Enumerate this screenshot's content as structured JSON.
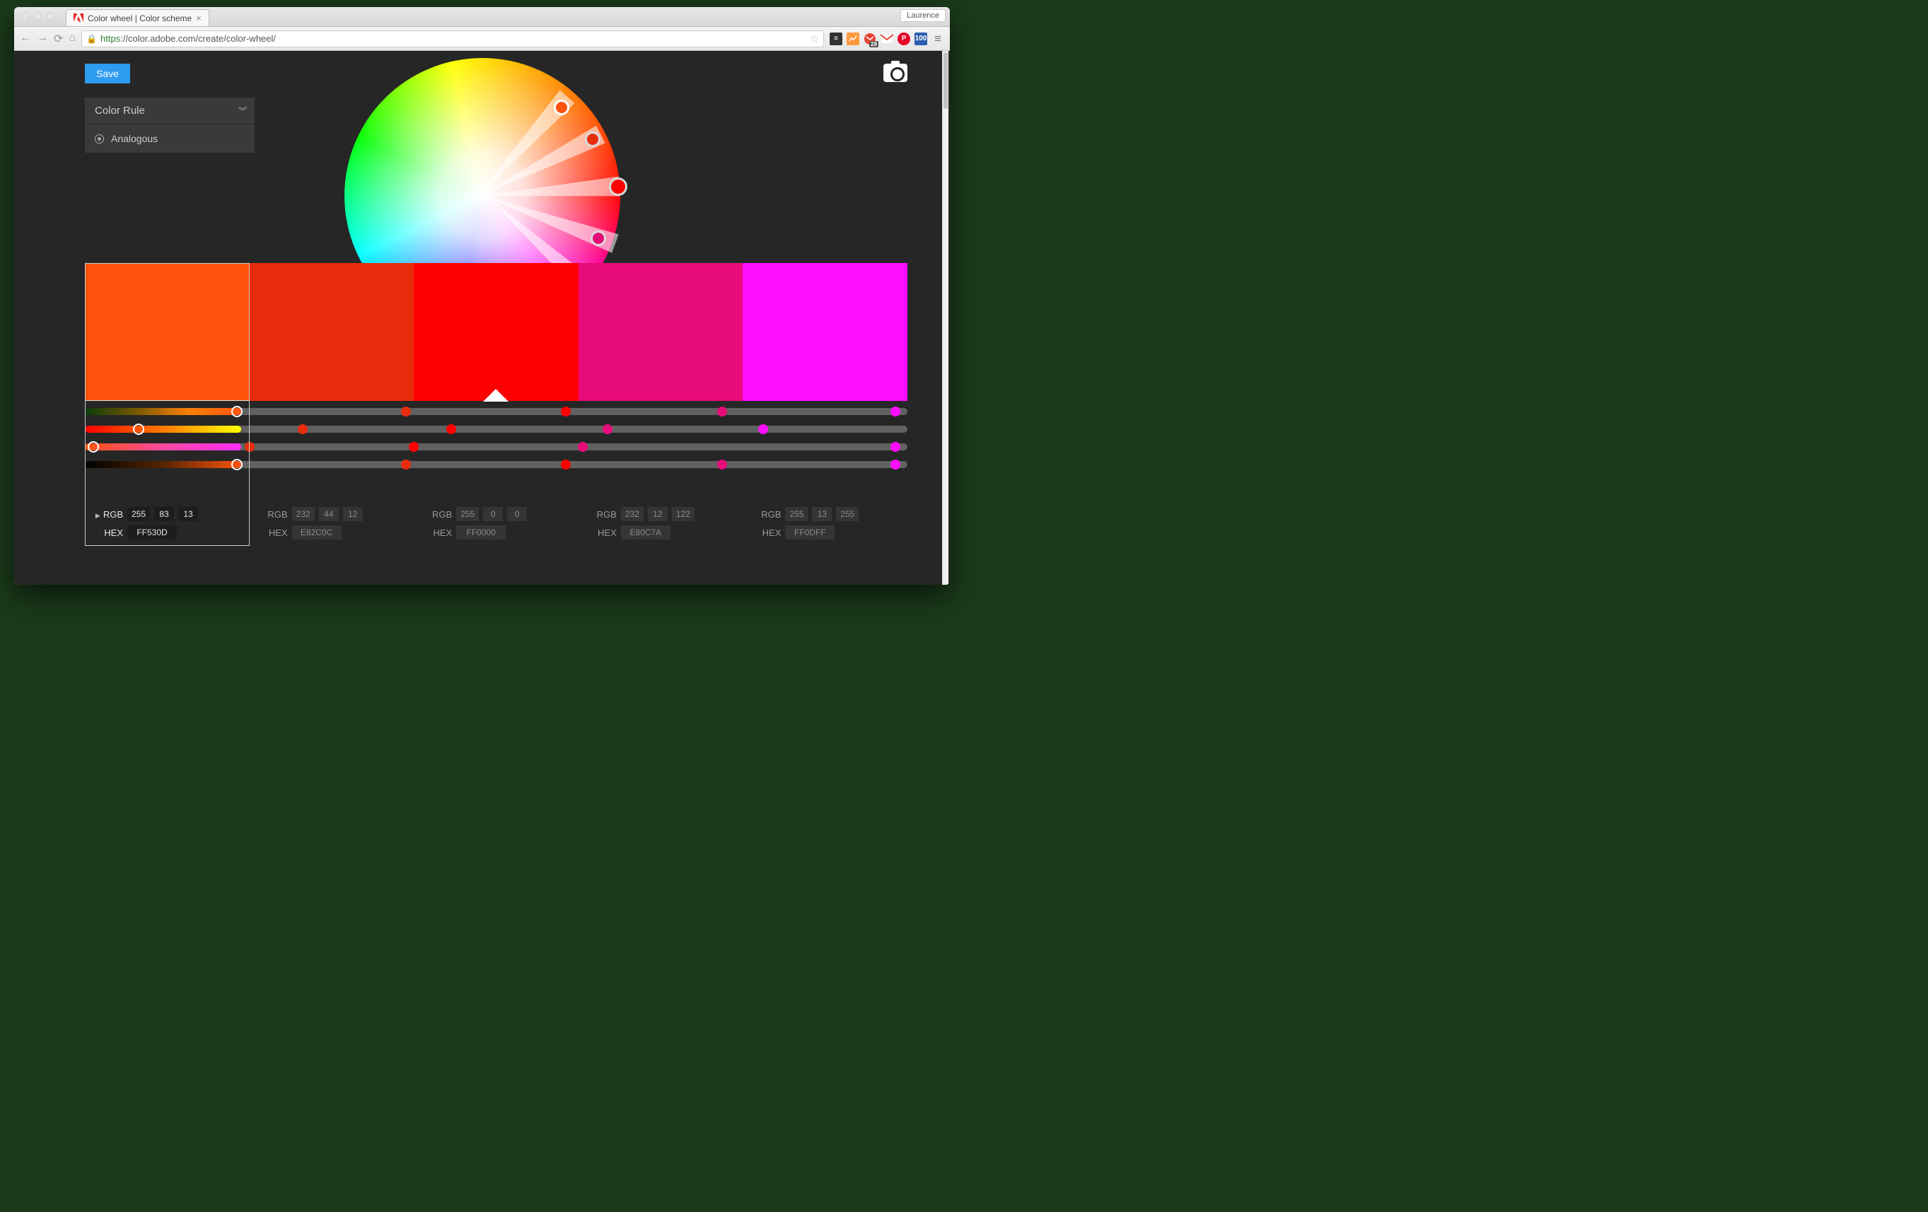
{
  "browser": {
    "profile": "Laurence",
    "tab_title": "Color wheel | Color scheme",
    "url_scheme": "https",
    "url_host_path": "://color.adobe.com/create/color-wheel/",
    "ext_badge": "28",
    "ext_100": "100"
  },
  "app": {
    "save_label": "Save",
    "rule_heading": "Color Rule",
    "rule_selected": "Analogous",
    "labels": {
      "rgb": "RGB",
      "hex": "HEX"
    }
  },
  "swatches": [
    {
      "hex": "FF530D",
      "rgb": [
        255,
        83,
        13
      ],
      "selected": true,
      "base": false
    },
    {
      "hex": "E82C0C",
      "rgb": [
        232,
        44,
        12
      ],
      "selected": false,
      "base": false
    },
    {
      "hex": "FF0000",
      "rgb": [
        255,
        0,
        0
      ],
      "selected": false,
      "base": true
    },
    {
      "hex": "E80C7A",
      "rgb": [
        232,
        12,
        122
      ],
      "selected": false,
      "base": false
    },
    {
      "hex": "FF0DFF",
      "rgb": [
        255,
        13,
        255
      ],
      "selected": false,
      "base": false
    }
  ],
  "wheel_handles": [
    {
      "angle": -48,
      "radius": 0.86,
      "color": "#FF530D",
      "base": false
    },
    {
      "angle": -27,
      "radius": 0.9,
      "color": "#E82C0C",
      "base": false
    },
    {
      "angle": -4,
      "radius": 0.99,
      "color": "#FF0000",
      "base": true
    },
    {
      "angle": 20,
      "radius": 0.9,
      "color": "#E80C7A",
      "base": false
    },
    {
      "angle": 42,
      "radius": 0.86,
      "color": "#FF0DFF",
      "base": false
    }
  ],
  "slider_rows": [
    {
      "kind": "h",
      "dots": [
        0.185,
        0.39,
        0.585,
        0.775,
        0.985
      ]
    },
    {
      "kind": "s",
      "dots": [
        0.065,
        0.265,
        0.445,
        0.635,
        0.825
      ]
    },
    {
      "kind": "s2",
      "dots": [
        0.01,
        0.2,
        0.4,
        0.605,
        0.985
      ]
    },
    {
      "kind": "v",
      "dots": [
        0.185,
        0.39,
        0.585,
        0.775,
        0.985
      ]
    }
  ]
}
